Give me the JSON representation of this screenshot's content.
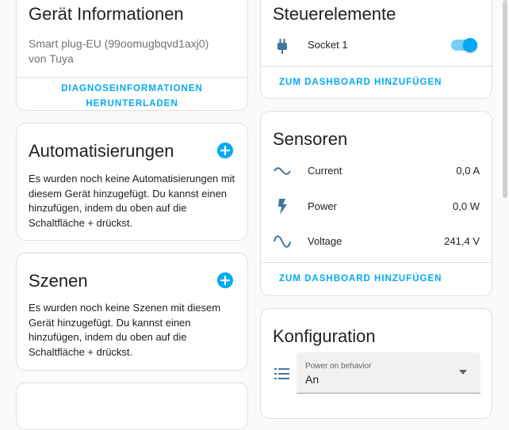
{
  "device_info": {
    "title": "Gerät Informationen",
    "model": "Smart plug-EU (99oomugbqvd1axj0)",
    "manufacturer": "von Tuya",
    "download_line1": "DIAGNOSEINFORMATIONEN",
    "download_line2": "HERUNTERLADEN"
  },
  "automations": {
    "title": "Automatisierungen",
    "text_lines": [
      "Es wurden noch keine Automatisierungen mit",
      "diesem Gerät hinzugefügt. Du kannst einen",
      "hinzufügen, indem du oben auf die",
      "Schaltfläche + drückst."
    ]
  },
  "scenes": {
    "title": "Szenen",
    "text_lines": [
      "Es wurden noch keine Szenen mit diesem",
      "Gerät hinzugefügt. Du kannst einen",
      "hinzufügen, indem du oben auf die",
      "Schaltfläche + drückst."
    ]
  },
  "controls": {
    "title": "Steuerelemente",
    "socket_label": "Socket 1",
    "socket_on": true,
    "add_to_dashboard": "ZUM DASHBOARD HINZUFÜGEN"
  },
  "sensors": {
    "title": "Sensoren",
    "rows": [
      {
        "label": "Current",
        "value": "0,0 A",
        "icon": "current-ac-icon"
      },
      {
        "label": "Power",
        "value": "0,0 W",
        "icon": "flash-icon"
      },
      {
        "label": "Voltage",
        "value": "241,4 V",
        "icon": "sine-wave-icon"
      }
    ],
    "add_to_dashboard": "ZUM DASHBOARD HINZUFÜGEN"
  },
  "configuration": {
    "title": "Konfiguration",
    "select_label": "Power on behavior",
    "select_value": "An",
    "icon": "list-icon"
  },
  "colors": {
    "accent": "#03a9f4",
    "card_bg": "#ffffff",
    "page_bg": "#fafafa"
  }
}
